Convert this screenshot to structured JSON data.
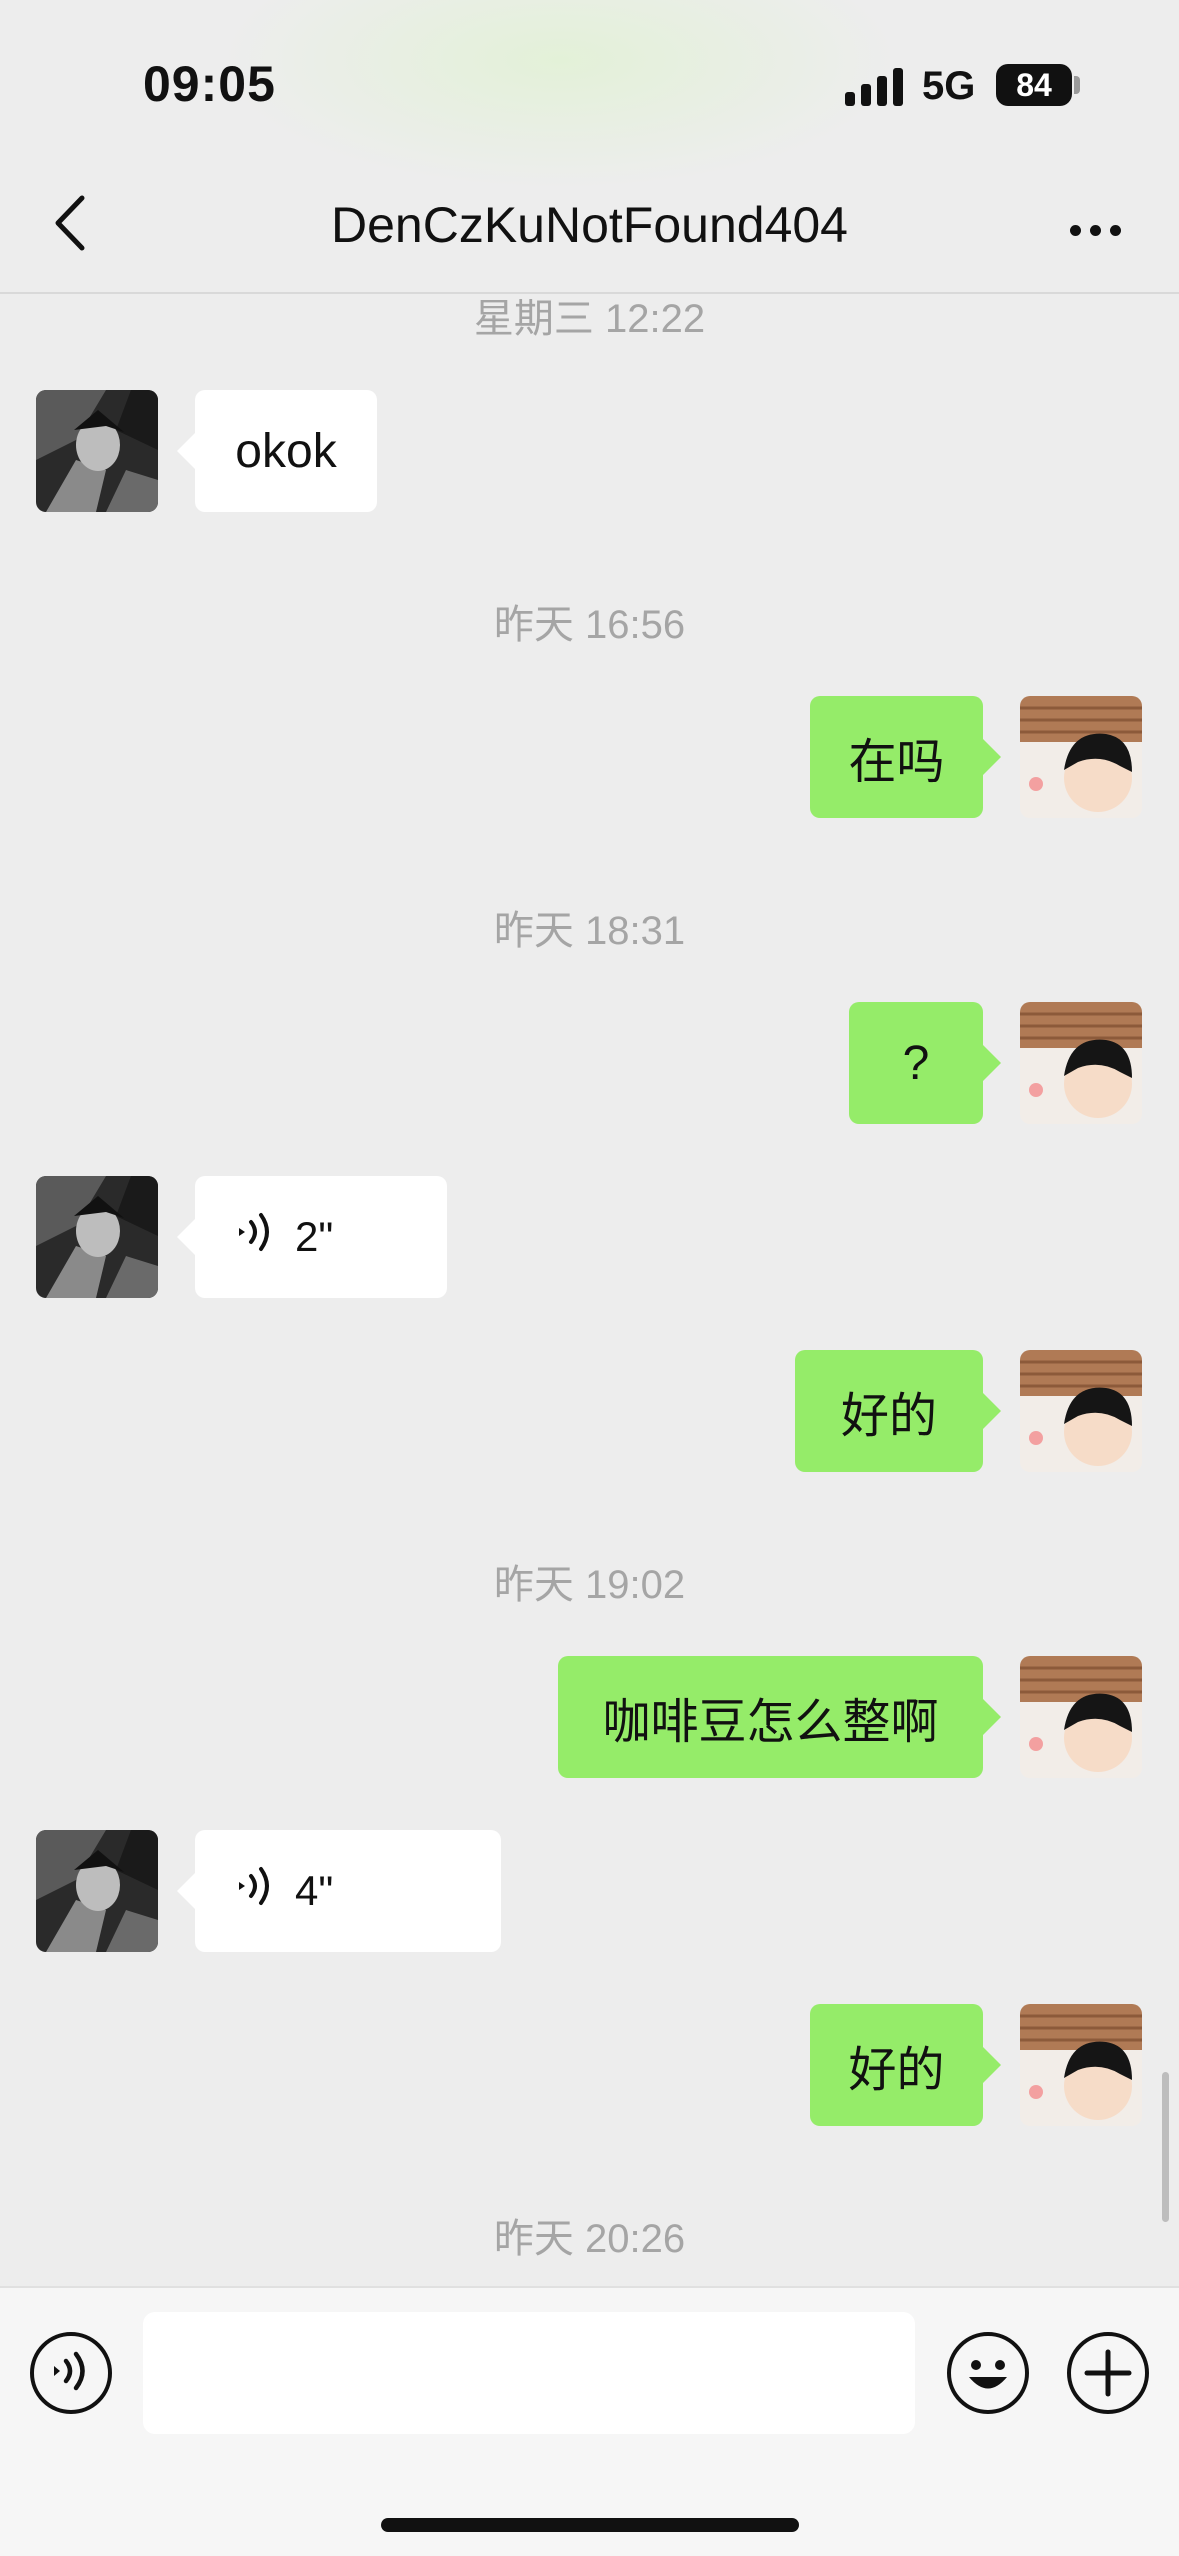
{
  "status_bar": {
    "time": "09:05",
    "network": "5G",
    "battery": "84"
  },
  "nav": {
    "back_icon": "chevron-left-icon",
    "title": "DenCzKuNotFound404",
    "more_icon": "more-dots-icon"
  },
  "messages": [
    {
      "type": "timestamp",
      "text": "星期三 12:22"
    },
    {
      "type": "text",
      "from": "peer",
      "text": "okok"
    },
    {
      "type": "timestamp",
      "text": "昨天 16:56"
    },
    {
      "type": "text",
      "from": "me",
      "text": "在吗"
    },
    {
      "type": "timestamp",
      "text": "昨天 18:31"
    },
    {
      "type": "text",
      "from": "me",
      "text": "?"
    },
    {
      "type": "voice",
      "from": "peer",
      "duration": "2\""
    },
    {
      "type": "text",
      "from": "me",
      "text": "好的"
    },
    {
      "type": "timestamp",
      "text": "昨天 19:02"
    },
    {
      "type": "text",
      "from": "me",
      "text": "咖啡豆怎么整啊"
    },
    {
      "type": "voice",
      "from": "peer",
      "duration": "4\""
    },
    {
      "type": "text",
      "from": "me",
      "text": "好的"
    },
    {
      "type": "timestamp",
      "text": "昨天 20:26"
    }
  ],
  "input_bar": {
    "voice_icon": "voice-input-icon",
    "text_value": "",
    "emoji_icon": "emoji-icon",
    "plus_icon": "plus-icon"
  },
  "colors": {
    "background": "#ededed",
    "my_bubble": "#95ec69",
    "peer_bubble": "#ffffff",
    "timestamp": "#a5a5a5"
  }
}
